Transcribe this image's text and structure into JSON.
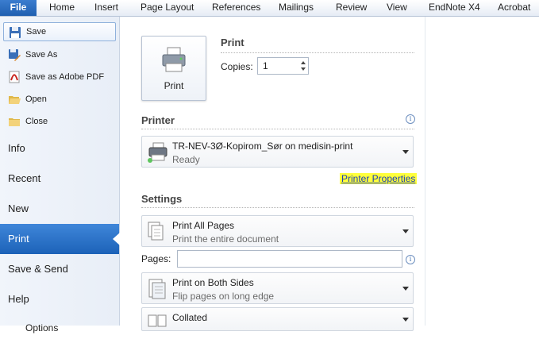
{
  "ribbon": {
    "tabs": [
      "File",
      "Home",
      "Insert",
      "Page Layout",
      "References",
      "Mailings",
      "Review",
      "View",
      "EndNote X4",
      "Acrobat"
    ]
  },
  "backstage": {
    "commands": [
      {
        "label": "Save",
        "icon": "save-icon",
        "selected": true
      },
      {
        "label": "Save As",
        "icon": "save-as-icon"
      },
      {
        "label": "Save as Adobe PDF",
        "icon": "adobe-pdf-icon"
      },
      {
        "label": "Open",
        "icon": "open-folder-icon"
      },
      {
        "label": "Close",
        "icon": "close-folder-icon"
      }
    ],
    "tabs": [
      {
        "label": "Info"
      },
      {
        "label": "Recent"
      },
      {
        "label": "New"
      },
      {
        "label": "Print",
        "active": true
      },
      {
        "label": "Save & Send"
      },
      {
        "label": "Help"
      },
      {
        "label": "Options"
      }
    ]
  },
  "print": {
    "button_label": "Print",
    "heading": "Print",
    "copies_label": "Copies:",
    "copies_value": "1"
  },
  "printer": {
    "heading": "Printer",
    "name": "TR-NEV-3Ø-Kopirom_Sør on medisin-print",
    "status": "Ready",
    "properties_link": "Printer Properties"
  },
  "settings": {
    "heading": "Settings",
    "pages_label": "Pages:",
    "pages_value": "",
    "items": [
      {
        "title": "Print All Pages",
        "subtitle": "Print the entire document"
      },
      {
        "title": "Print on Both Sides",
        "subtitle": "Flip pages on long edge"
      },
      {
        "title": "Collated",
        "subtitle": ""
      }
    ]
  },
  "colors": {
    "file_tab": "#1f5fb0",
    "active_nav": "#1c62b8",
    "highlight": "#ffff3b",
    "link": "#1a3fb4"
  }
}
